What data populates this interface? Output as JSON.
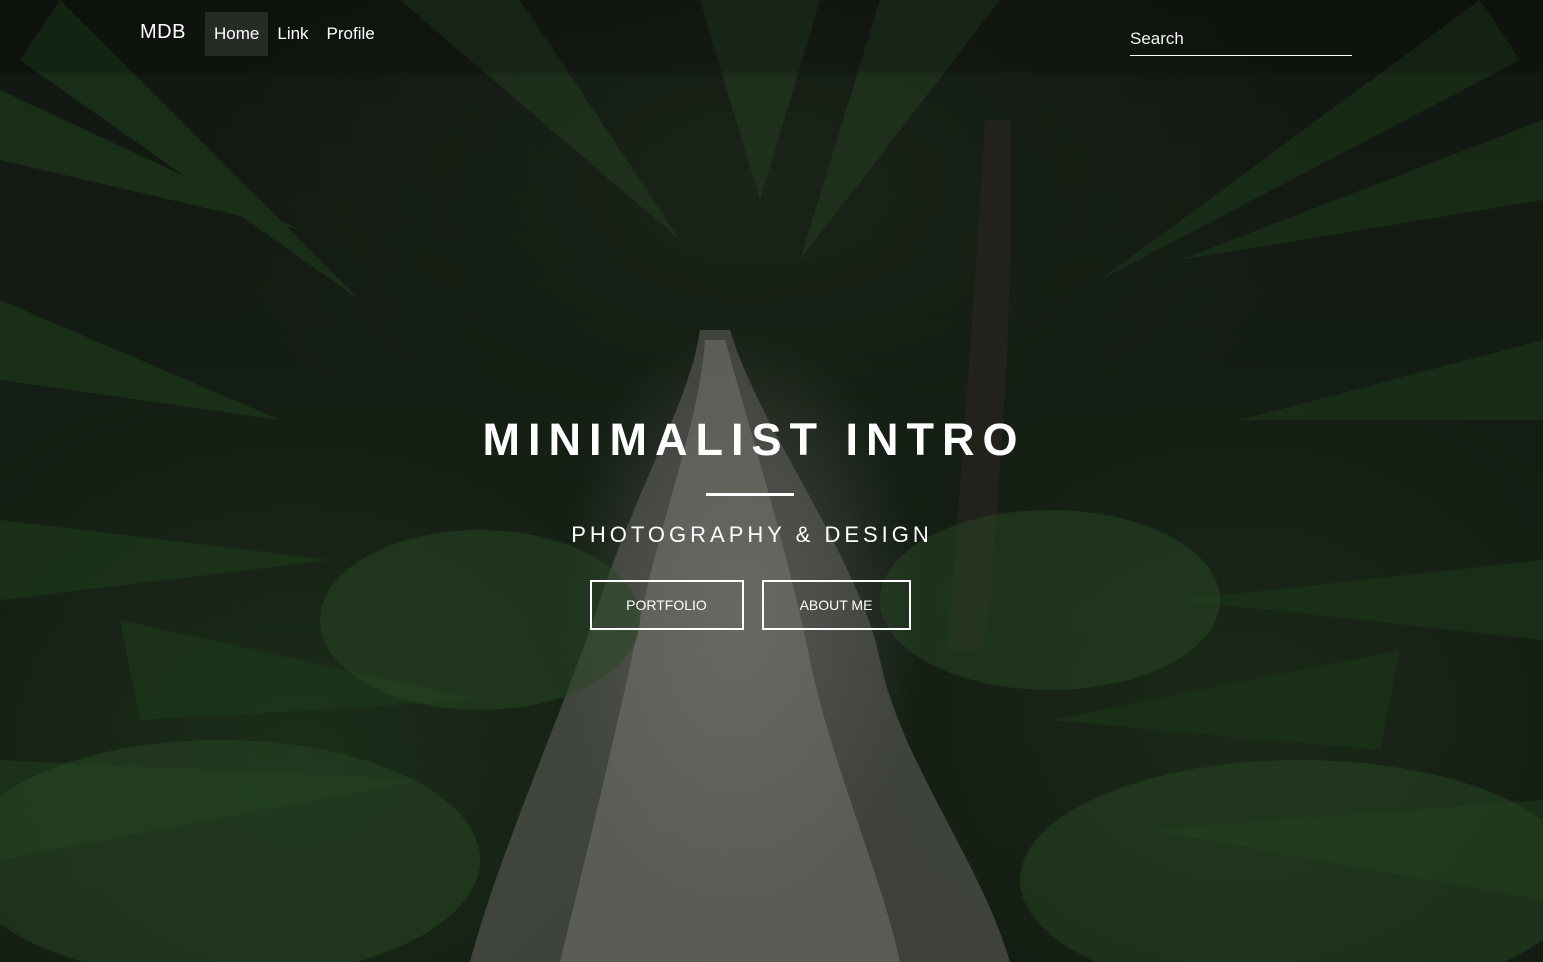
{
  "navbar": {
    "brand": "MDB",
    "links": [
      {
        "label": "Home",
        "active": true
      },
      {
        "label": "Link",
        "active": false
      },
      {
        "label": "Profile",
        "active": false
      }
    ],
    "search_placeholder": "Search"
  },
  "hero": {
    "title": "MINIMALIST INTRO",
    "subtitle": "PHOTOGRAPHY & DESIGN",
    "buttons": {
      "portfolio": "PORTFOLIO",
      "about": "ABOUT ME"
    }
  },
  "colors": {
    "text": "#ffffff",
    "overlay": "#000000",
    "foliage": "#2d4a29",
    "path": "#bebeb9"
  }
}
